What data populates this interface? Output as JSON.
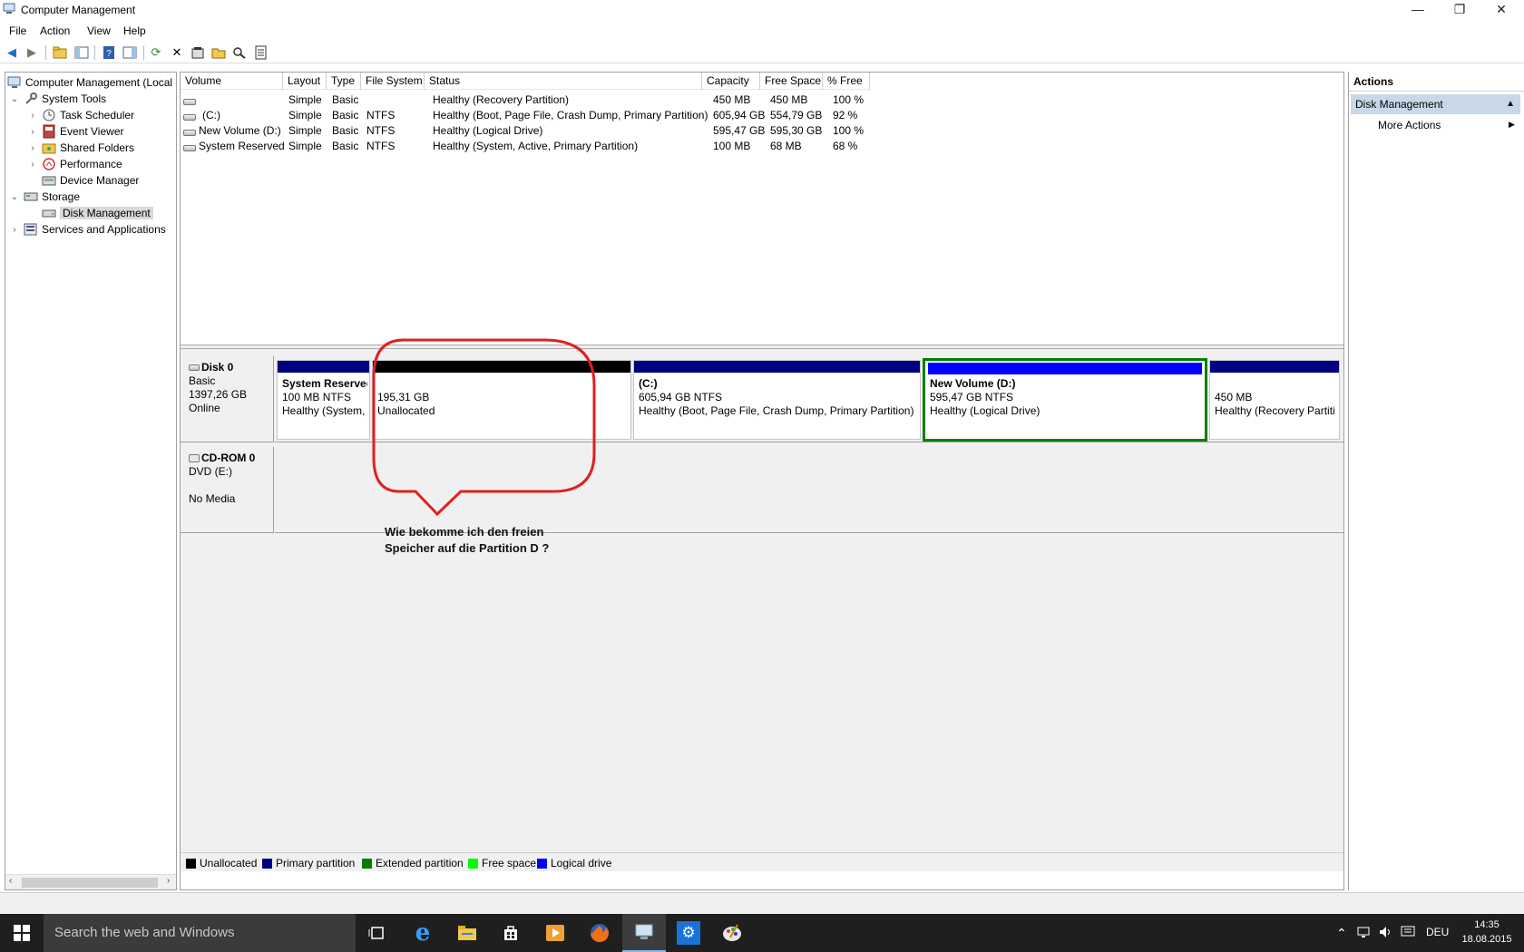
{
  "window": {
    "title": "Computer Management",
    "controls": [
      "—",
      "❐",
      "✕"
    ]
  },
  "menu": [
    "File",
    "Action",
    "View",
    "Help"
  ],
  "tree": {
    "root": "Computer Management (Local",
    "system_tools": "System Tools",
    "task_scheduler": "Task Scheduler",
    "event_viewer": "Event Viewer",
    "shared_folders": "Shared Folders",
    "performance": "Performance",
    "device_manager": "Device Manager",
    "storage": "Storage",
    "disk_management": "Disk Management",
    "services": "Services and Applications"
  },
  "volume_table": {
    "columns": [
      "Volume",
      "Layout",
      "Type",
      "File System",
      "Status",
      "Capacity",
      "Free Space",
      "% Free"
    ],
    "rows": [
      [
        "",
        "Simple",
        "Basic",
        "",
        "Healthy (Recovery Partition)",
        "450 MB",
        "450 MB",
        "100 %"
      ],
      [
        "(C:)",
        "Simple",
        "Basic",
        "NTFS",
        "Healthy (Boot, Page File, Crash Dump, Primary Partition)",
        "605,94 GB",
        "554,79 GB",
        "92 %"
      ],
      [
        "New Volume (D:)",
        "Simple",
        "Basic",
        "NTFS",
        "Healthy (Logical Drive)",
        "595,47 GB",
        "595,30 GB",
        "100 %"
      ],
      [
        "System Reserved",
        "Simple",
        "Basic",
        "NTFS",
        "Healthy (System, Active, Primary Partition)",
        "100 MB",
        "68 MB",
        "68 %"
      ]
    ]
  },
  "disk0": {
    "name": "Disk 0",
    "type": "Basic",
    "size": "1397,26 GB",
    "state": "Online",
    "partitions": [
      {
        "name": "System Reserved",
        "size": "100 MB NTFS",
        "status": "Healthy (System, A"
      },
      {
        "name": "",
        "size": "195,31 GB",
        "status": "Unallocated"
      },
      {
        "name": "(C:)",
        "size": "605,94 GB NTFS",
        "status": "Healthy (Boot, Page File, Crash Dump, Primary Partition)"
      },
      {
        "name": "New Volume  (D:)",
        "size": "595,47 GB NTFS",
        "status": "Healthy (Logical Drive)"
      },
      {
        "name": "",
        "size": "450 MB",
        "status": "Healthy (Recovery Partiti"
      }
    ]
  },
  "cdrom": {
    "name": "CD-ROM 0",
    "type": "DVD (E:)",
    "state": "No Media"
  },
  "legend": [
    "Unallocated",
    "Primary partition",
    "Extended partition",
    "Free space",
    "Logical drive"
  ],
  "colors": {
    "unallocated": "#000000",
    "primary": "#000080",
    "extended": "#008000",
    "free": "#00ff00",
    "logical": "#0000ff",
    "annotation": "#e02020"
  },
  "actions": {
    "title": "Actions",
    "section": "Disk Management",
    "more": "More Actions"
  },
  "annotation": {
    "line1": "Wie bekomme ich den freien",
    "line2": "Speicher auf die Partition D ?"
  },
  "taskbar": {
    "search_placeholder": "Search the web and Windows",
    "language": "DEU",
    "time": "14:35",
    "date": "18.08.2015"
  }
}
